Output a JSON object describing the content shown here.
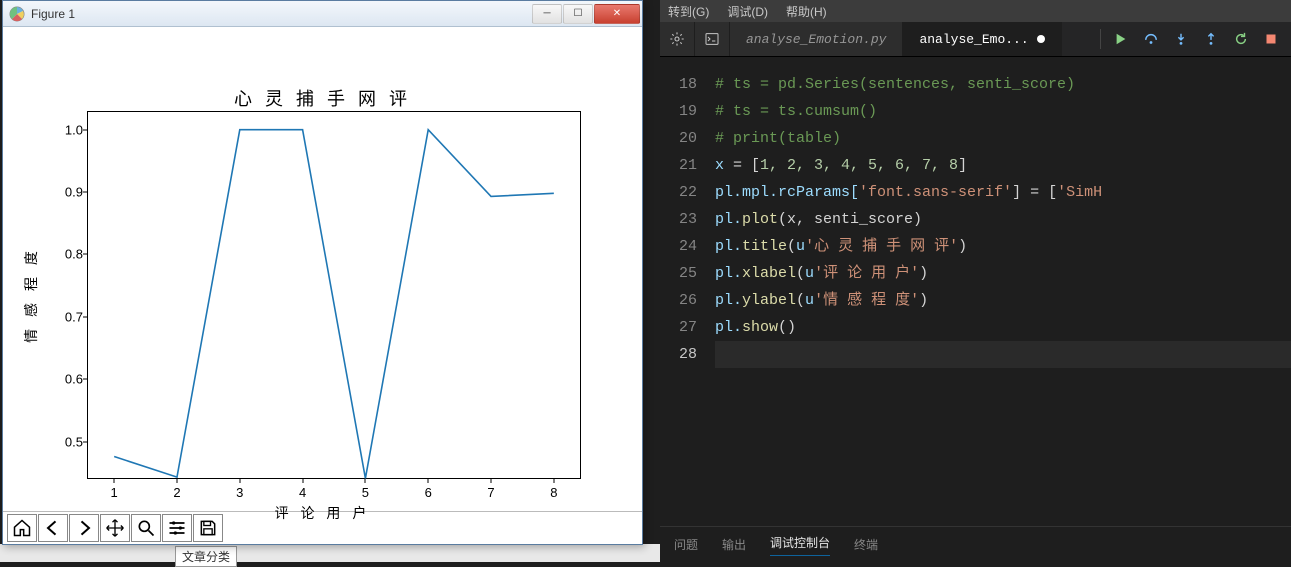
{
  "figure": {
    "window_title": "Figure 1",
    "toolbar": {
      "home": "home",
      "back": "back",
      "forward": "forward",
      "pan": "pan",
      "zoom": "zoom",
      "configure": "configure",
      "save": "save"
    }
  },
  "chart_data": {
    "type": "line",
    "title": "心 灵 捕 手 网 评",
    "xlabel": "评 论 用 户",
    "ylabel": "情 感 程 度",
    "x": [
      1,
      2,
      3,
      4,
      5,
      6,
      7,
      8
    ],
    "values": [
      0.476,
      0.443,
      1.0,
      1.0,
      0.441,
      1.0,
      0.893,
      0.898
    ],
    "xticks": [
      1,
      2,
      3,
      4,
      5,
      6,
      7,
      8
    ],
    "yticks": [
      0.5,
      0.6,
      0.7,
      0.8,
      0.9,
      1.0
    ],
    "ylim": [
      0.44,
      1.03
    ]
  },
  "editor": {
    "menu": {
      "goto": "转到(G)",
      "debug": "调试(D)",
      "help": "帮助(H)"
    },
    "tabs": {
      "inactive": "analyse_Emotion.py",
      "active": "analyse_Emo..."
    },
    "lines": [
      {
        "n": 18,
        "text": "# ts = pd.Series(sentences, senti_score)"
      },
      {
        "n": 19,
        "text": "# ts = ts.cumsum()"
      },
      {
        "n": 20,
        "text": "# print(table)"
      },
      {
        "n": 21,
        "raw": true
      },
      {
        "n": 22,
        "raw": true
      },
      {
        "n": 23,
        "raw": true
      },
      {
        "n": 24,
        "raw": true
      },
      {
        "n": 25,
        "raw": true
      },
      {
        "n": 26,
        "raw": true
      },
      {
        "n": 27,
        "raw": true
      },
      {
        "n": 28,
        "text": ""
      }
    ],
    "code21_x": "x ",
    "code21_eq": "= [",
    "code21_nums": "1, 2, 3, 4, 5, 6, 7, 8",
    "code21_end": "]",
    "code22_a": "pl.mpl.rcParams[",
    "code22_s1": "'font.sans-serif'",
    "code22_b": "] = [",
    "code22_s2": "'SimH",
    "code23_a": "pl.",
    "code23_f": "plot",
    "code23_b": "(x, senti_score)",
    "code24_a": "pl.",
    "code24_f": "title",
    "code24_b": "(",
    "code24_u": "u",
    "code24_s": "'心 灵 捕 手 网 评'",
    "code24_c": ")",
    "code25_a": "pl.",
    "code25_f": "xlabel",
    "code25_b": "(",
    "code25_u": "u",
    "code25_s": "'评 论 用 户'",
    "code25_c": ")",
    "code26_a": "pl.",
    "code26_f": "ylabel",
    "code26_b": "(",
    "code26_u": "u",
    "code26_s": "'情 感 程 度'",
    "code26_c": ")",
    "code27_a": "pl.",
    "code27_f": "show",
    "code27_b": "()",
    "bottom": {
      "problems": "问题",
      "output": "输出",
      "debug_console": "调试控制台",
      "terminal": "终端"
    }
  },
  "bg": {
    "chip1": "文章分类"
  }
}
